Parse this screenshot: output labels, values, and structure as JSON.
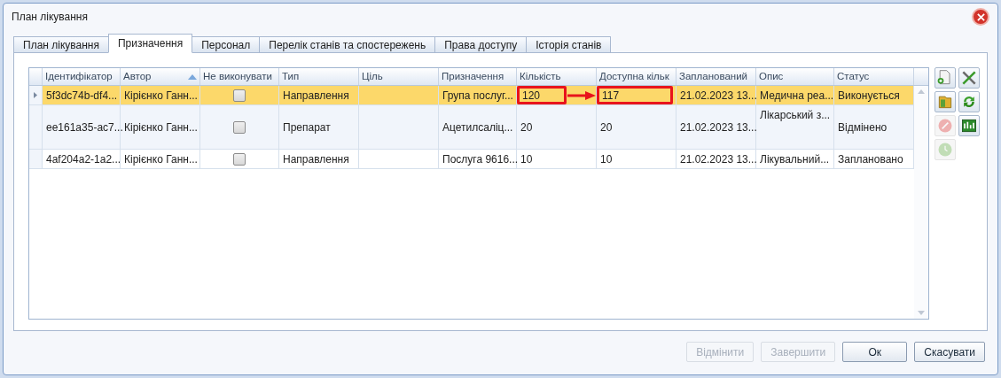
{
  "window": {
    "title": "План лікування"
  },
  "tabs": [
    {
      "label": "План лікування",
      "selected": false
    },
    {
      "label": "Призначення",
      "selected": true
    },
    {
      "label": "Персонал",
      "selected": false
    },
    {
      "label": "Перелік станів та спостережень",
      "selected": false
    },
    {
      "label": "Права доступу",
      "selected": false
    },
    {
      "label": "Історія станів",
      "selected": false
    }
  ],
  "table": {
    "columns": [
      {
        "label": "Ідентифікатор"
      },
      {
        "label": "Автор",
        "sorted": true
      },
      {
        "label": "Не виконувати"
      },
      {
        "label": "Тип"
      },
      {
        "label": "Ціль"
      },
      {
        "label": "Призначення"
      },
      {
        "label": "Кількість"
      },
      {
        "label": "Доступна кільк"
      },
      {
        "label": "Запланований"
      },
      {
        "label": "Опис"
      },
      {
        "label": "Статус"
      }
    ],
    "rows": [
      {
        "selected": true,
        "tall": false,
        "cells": [
          {
            "kind": "text",
            "text": "5f3dc74b-df4..."
          },
          {
            "kind": "text",
            "text": "Кірієнко Ганн..."
          },
          {
            "kind": "checkbox",
            "checked": false
          },
          {
            "kind": "text",
            "text": "Направлення"
          },
          {
            "kind": "empty"
          },
          {
            "kind": "text",
            "text": "Група послуг..."
          },
          {
            "kind": "text",
            "text": "120",
            "outlined": true
          },
          {
            "kind": "text",
            "text": "117",
            "outlined": true
          },
          {
            "kind": "text",
            "text": "21.02.2023 13..."
          },
          {
            "kind": "text",
            "text": "Медична реа..."
          },
          {
            "kind": "text",
            "text": "Виконується"
          }
        ]
      },
      {
        "selected": false,
        "tall": true,
        "cells": [
          {
            "kind": "text",
            "text": "ee161a35-ac7..."
          },
          {
            "kind": "text",
            "text": "Кірієнко Ганн..."
          },
          {
            "kind": "checkbox",
            "checked": false
          },
          {
            "kind": "text",
            "text": "Препарат"
          },
          {
            "kind": "empty"
          },
          {
            "kind": "text",
            "text": "Ацетилсаліц..."
          },
          {
            "kind": "text",
            "text": "20"
          },
          {
            "kind": "text",
            "text": "20"
          },
          {
            "kind": "text",
            "text": "21.02.2023 13..."
          },
          {
            "kind": "top",
            "text": "Лікарський з..."
          },
          {
            "kind": "text",
            "text": "Відмінено"
          }
        ]
      },
      {
        "selected": false,
        "tall": false,
        "cells": [
          {
            "kind": "text",
            "text": "4af204a2-1a2..."
          },
          {
            "kind": "text",
            "text": "Кірієнко Ганн..."
          },
          {
            "kind": "checkbox",
            "checked": false
          },
          {
            "kind": "text",
            "text": "Направлення"
          },
          {
            "kind": "empty"
          },
          {
            "kind": "text",
            "text": "Послуга 9616..."
          },
          {
            "kind": "text",
            "text": "10"
          },
          {
            "kind": "text",
            "text": "10"
          },
          {
            "kind": "text",
            "text": "21.02.2023 13..."
          },
          {
            "kind": "text",
            "text": "Лікувальний..."
          },
          {
            "kind": "text",
            "text": "Заплановано"
          }
        ]
      }
    ]
  },
  "toolbar": [
    {
      "kind": "add",
      "disabled": false
    },
    {
      "kind": "tools",
      "disabled": false
    },
    {
      "kind": "folder",
      "disabled": false
    },
    {
      "kind": "refresh",
      "disabled": false
    },
    {
      "kind": "cancel",
      "disabled": true
    },
    {
      "kind": "chart",
      "disabled": false
    },
    {
      "kind": "clock",
      "disabled": true
    }
  ],
  "buttons": [
    {
      "label": "Відмінити",
      "disabled": true
    },
    {
      "label": "Завершити",
      "disabled": true
    },
    {
      "label": "Ок",
      "disabled": false
    },
    {
      "label": "Скасувати",
      "disabled": false
    }
  ]
}
